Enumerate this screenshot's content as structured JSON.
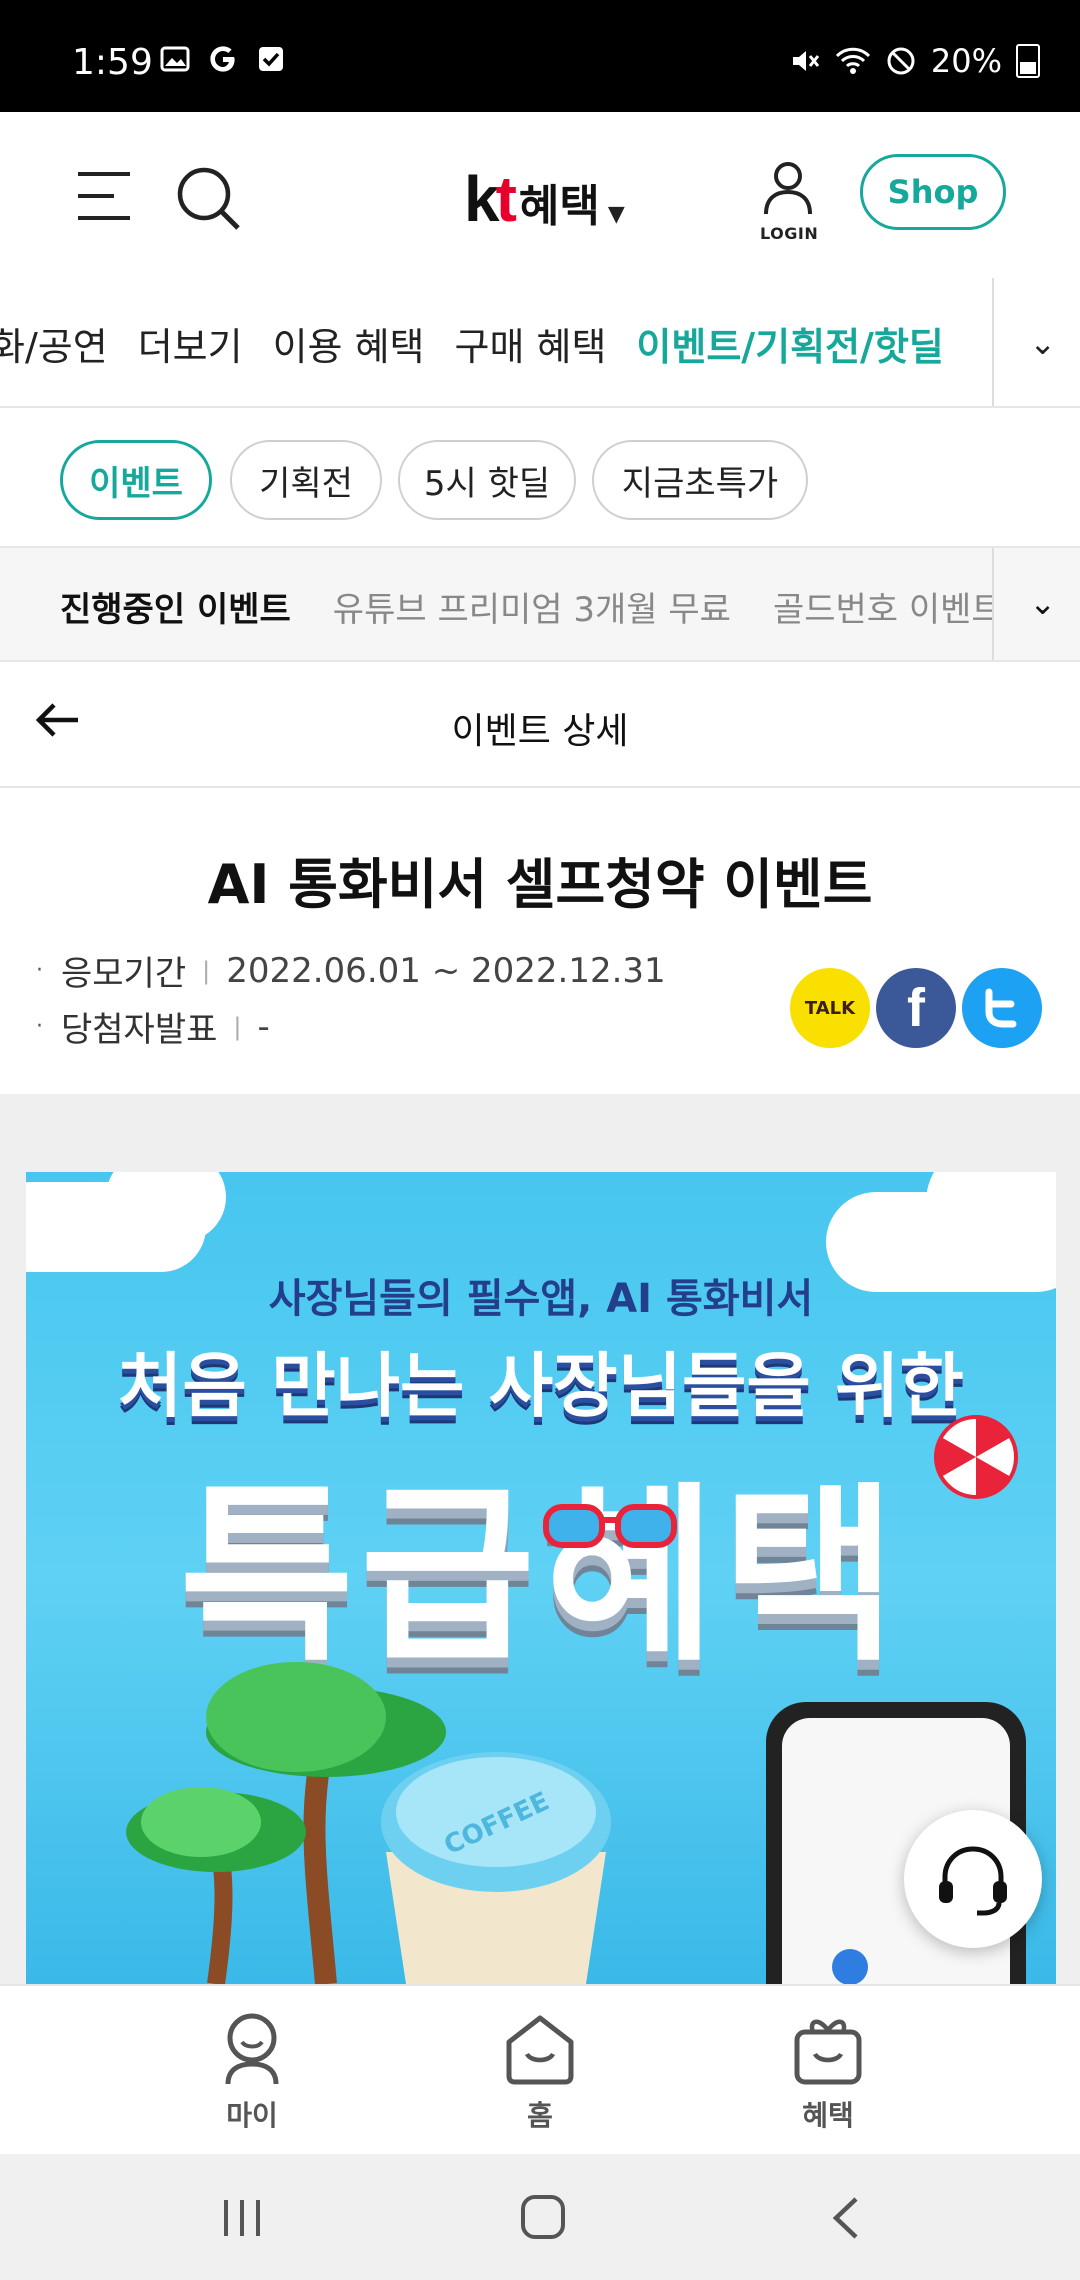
{
  "status_bar": {
    "time": "1:59",
    "battery": "20%",
    "icons": [
      "image-icon",
      "google-icon",
      "checkbox-icon",
      "mute-icon",
      "wifi-icon",
      "dnd-icon",
      "battery-icon"
    ]
  },
  "header": {
    "logo_kt": "kt",
    "logo_text": "혜택",
    "login_label": "LOGIN",
    "shop_label": "Shop",
    "accent_color": "#16a99b"
  },
  "category_tabs": [
    {
      "label": "화/공연",
      "active": false
    },
    {
      "label": "더보기",
      "active": false
    },
    {
      "label": "이용 혜택",
      "active": false
    },
    {
      "label": "구매 혜택",
      "active": false
    },
    {
      "label": "이벤트/기획전/핫딜",
      "active": true
    }
  ],
  "pills": [
    {
      "label": "이벤트",
      "active": true
    },
    {
      "label": "기획전",
      "active": false
    },
    {
      "label": "5시 핫딜",
      "active": false
    },
    {
      "label": "지금초특가",
      "active": false
    }
  ],
  "sub_tabs": [
    {
      "label": "진행중인 이벤트",
      "active": true
    },
    {
      "label": "유튜브 프리미엄 3개월 무료",
      "active": false
    },
    {
      "label": "골드번호 이벤트",
      "active": false
    }
  ],
  "detail": {
    "header_title": "이벤트 상세",
    "event_title": "AI 통화비서 셀프청약 이벤트",
    "period_label": "응모기간",
    "period_value": "2022.06.01 ~ 2022.12.31",
    "winner_label": "당첨자발표",
    "winner_value": "-",
    "share": {
      "kakao_label": "TALK"
    }
  },
  "banner": {
    "subtitle": "사장님들의 필수앱, AI 통화비서",
    "headline": "처음 만나는 사장님들을 위한",
    "big_text": "특급혜택",
    "cup_text": "COFFEE"
  },
  "bottom_nav": [
    {
      "label": "마이",
      "icon": "my-icon"
    },
    {
      "label": "홈",
      "icon": "home-icon"
    },
    {
      "label": "혜택",
      "icon": "gift-icon"
    }
  ]
}
